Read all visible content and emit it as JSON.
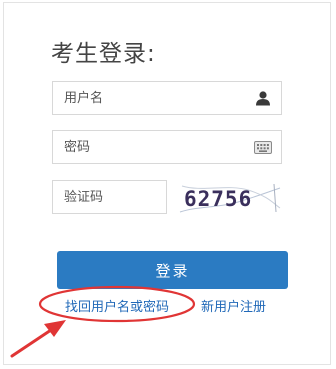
{
  "login": {
    "title": "考生登录:",
    "username_placeholder": "用户名",
    "password_placeholder": "密码",
    "captcha_placeholder": "验证码",
    "captcha_text": "62756",
    "submit_label": "登录",
    "forgot_link": "找回用户名或密码",
    "register_link": "新用户注册"
  },
  "icons": {
    "username": "user-icon",
    "password": "keyboard-icon"
  },
  "colors": {
    "button": "#2b7bc2",
    "link": "#2169b8",
    "annotation": "#e03535"
  }
}
